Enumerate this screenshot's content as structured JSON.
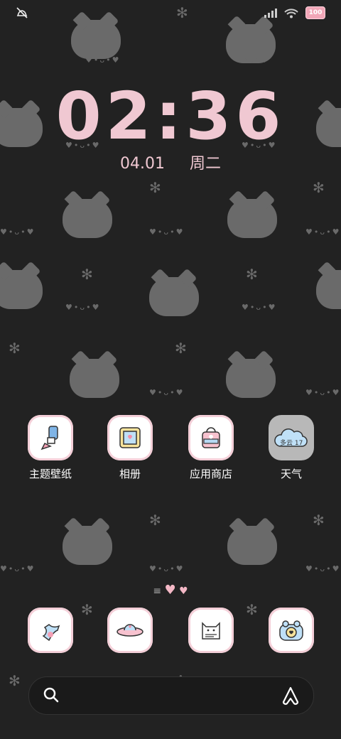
{
  "status_bar": {
    "left_icon": "mute-vibrate-icon",
    "battery": "100"
  },
  "clock": {
    "time": "02:36"
  },
  "date": {
    "day": "04.01",
    "weekday": "周二"
  },
  "apps": [
    {
      "label": "主题壁纸",
      "icon": "paint-brush-icon"
    },
    {
      "label": "相册",
      "icon": "photo-frame-icon"
    },
    {
      "label": "应用商店",
      "icon": "shopping-bag-icon"
    },
    {
      "label": "天气",
      "icon": "cloud-icon",
      "widget_text": "多云 17"
    }
  ],
  "dock": [
    {
      "icon": "phone-icon"
    },
    {
      "icon": "ufo-message-icon"
    },
    {
      "icon": "cat-icon"
    },
    {
      "icon": "camera-frog-icon"
    }
  ],
  "search": {
    "left_icon": "search-icon",
    "right_icon": "assistant-icon"
  }
}
